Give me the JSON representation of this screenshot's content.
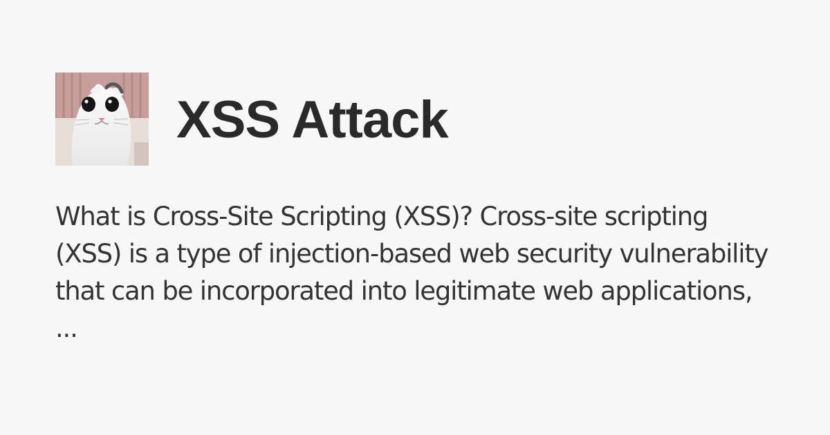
{
  "card": {
    "title": "XSS Attack",
    "description": "What is Cross-Site Scripting (XSS)? Cross-site scripting (XSS) is a type of injection-based web security vulnerability that can be incorporated into legitimate web applications, ...",
    "avatar": {
      "icon": "cat-photo-icon"
    }
  },
  "colors": {
    "background": "#f8f7f8",
    "title": "#2a2a2a",
    "text": "#333333"
  }
}
